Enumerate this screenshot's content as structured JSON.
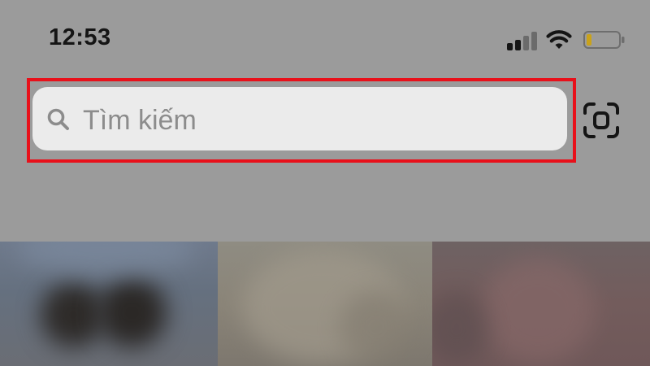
{
  "status_bar": {
    "time": "12:53",
    "icons": [
      "signal-icon",
      "wifi-icon",
      "battery-icon"
    ],
    "battery_level": 0.15
  },
  "search": {
    "placeholder": "Tìm kiếm",
    "icon": "search-icon"
  },
  "scan_button": {
    "icon": "scan-icon"
  },
  "highlight": {
    "color": "#e8101a"
  },
  "photo_grid": {
    "items": [
      {
        "name": "photo-thumbnail-1"
      },
      {
        "name": "photo-thumbnail-2"
      },
      {
        "name": "photo-thumbnail-3"
      }
    ]
  }
}
